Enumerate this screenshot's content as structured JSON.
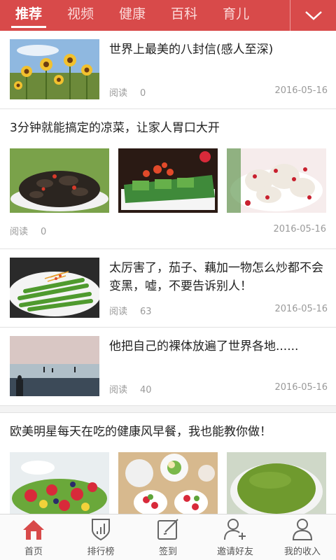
{
  "top_tabs": [
    {
      "label": "推荐",
      "active": true
    },
    {
      "label": "视频",
      "active": false
    },
    {
      "label": "健康",
      "active": false
    },
    {
      "label": "百科",
      "active": false
    },
    {
      "label": "育儿",
      "active": false
    }
  ],
  "more_icon": "chevron-down-icon",
  "feed": {
    "item1": {
      "title": "世界上最美的八封信(感人至深)",
      "read_label": "阅读",
      "read_count": "0",
      "date": "2016-05-16",
      "image": "sunflower-field-image"
    },
    "item2": {
      "title": "3分钟就能搞定的凉菜，让家人胃口大开",
      "read_label": "阅读",
      "read_count": "0",
      "date": "2016-05-16",
      "images": [
        "black-fungus-salad-image",
        "cucumber-chili-dish-image",
        "radish-pomegranate-image"
      ]
    },
    "item3": {
      "title": "太厉害了，茄子、藕加一物怎么炒都不会变黑，嘘，不要告诉别人！",
      "read_label": "阅读",
      "read_count": "63",
      "date": "2016-05-16",
      "image": "green-vegetable-plate-image"
    },
    "item4": {
      "title": "他把自己的裸体放遍了世界各地......",
      "read_label": "阅读",
      "read_count": "40",
      "date": "2016-05-16",
      "image": "beach-silhouettes-image"
    },
    "item5": {
      "title": "欧美明星每天在吃的健康风早餐，我也能教你做！",
      "images": [
        "fruit-salad-image",
        "breakfast-spread-image",
        "green-smoothie-image"
      ]
    }
  },
  "bottom_nav": [
    {
      "label": "首页",
      "icon": "home-icon",
      "active": true
    },
    {
      "label": "排行榜",
      "icon": "ranking-shield-icon",
      "active": false
    },
    {
      "label": "签到",
      "icon": "checkin-edit-icon",
      "active": false
    },
    {
      "label": "邀请好友",
      "icon": "add-friend-icon",
      "active": false
    },
    {
      "label": "我的收入",
      "icon": "profile-icon",
      "active": false
    }
  ],
  "colors": {
    "brand_red": "#d84a4a",
    "text_gray": "#9a9a9a"
  }
}
